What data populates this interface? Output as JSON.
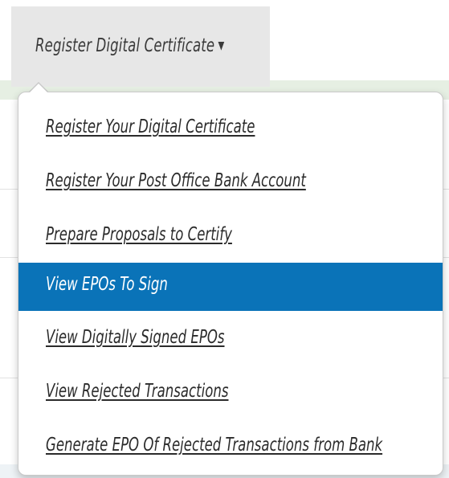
{
  "nav": {
    "tab_label": "Register Digital Certificate",
    "caret_icon": "caret-down-icon"
  },
  "menu": {
    "items": [
      {
        "label": "Register Your Digital Certificate",
        "active": false
      },
      {
        "label": "Register Your Post Office Bank Account",
        "active": false
      },
      {
        "label": "Prepare Proposals to Certify",
        "active": false
      },
      {
        "label": "View EPOs To Sign",
        "active": true
      },
      {
        "label": "View Digitally Signed EPOs",
        "active": false
      },
      {
        "label": "View Rejected Transactions",
        "active": false
      },
      {
        "label": "Generate EPO Of Rejected Transactions from Bank",
        "active": false
      }
    ]
  },
  "colors": {
    "active_bg": "#0a73b8",
    "tab_bg": "#e7e7e7"
  }
}
